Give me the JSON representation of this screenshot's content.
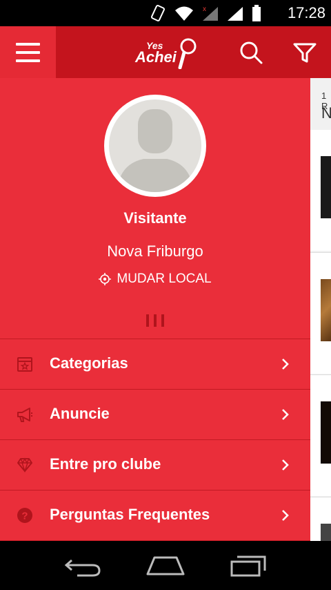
{
  "status_bar": {
    "time": "17:28"
  },
  "app_bar": {
    "logo_small": "Yes",
    "logo_big": "Achei"
  },
  "content_peek": {
    "small_text": "1 R",
    "big_text": "N"
  },
  "drawer": {
    "user_name": "Visitante",
    "city": "Nova Friburgo",
    "change_location": "MUDAR LOCAL",
    "menu": [
      {
        "label": "Categorias",
        "icon": "calendar-star-icon"
      },
      {
        "label": "Anuncie",
        "icon": "megaphone-icon"
      },
      {
        "label": "Entre pro clube",
        "icon": "diamond-icon"
      },
      {
        "label": "Perguntas Frequentes",
        "icon": "question-circle-icon"
      }
    ]
  },
  "colors": {
    "drawer_bg": "#ea2e3a",
    "appbar_bg": "#c4141d",
    "icon_dark_red": "#b0141c"
  }
}
